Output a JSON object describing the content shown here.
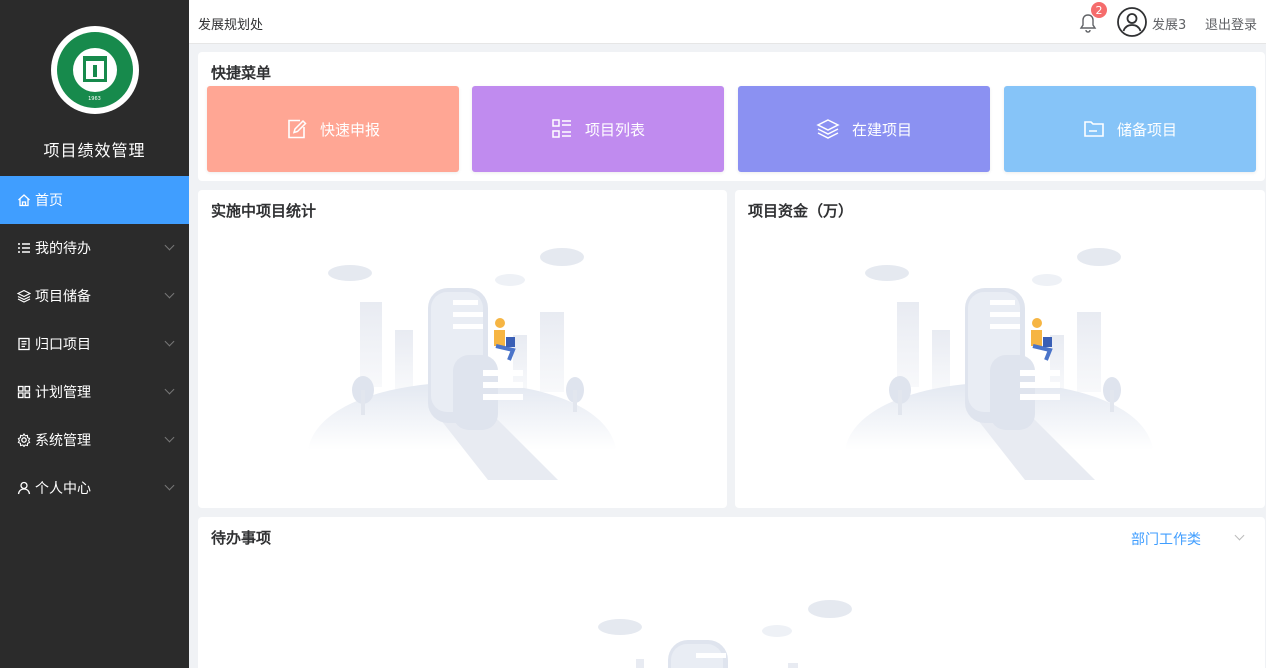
{
  "app": {
    "title": "项目绩效管理",
    "logo_year": "1963"
  },
  "sidebar": {
    "items": [
      {
        "label": "首页",
        "icon": "home-icon",
        "active": true
      },
      {
        "label": "我的待办",
        "icon": "list-icon",
        "active": false
      },
      {
        "label": "项目储备",
        "icon": "layers-icon",
        "active": false
      },
      {
        "label": "归口项目",
        "icon": "document-icon",
        "active": false
      },
      {
        "label": "计划管理",
        "icon": "grid-icon",
        "active": false
      },
      {
        "label": "系统管理",
        "icon": "gear-icon",
        "active": false
      },
      {
        "label": "个人中心",
        "icon": "user-icon",
        "active": false
      }
    ]
  },
  "header": {
    "title": "发展规划处",
    "notification_count": "2",
    "username": "发展3",
    "logout_label": "退出登录"
  },
  "quick_menu": {
    "title": "快捷菜单",
    "tiles": [
      {
        "label": "快速申报",
        "icon": "edit-icon",
        "color": "#ffa694"
      },
      {
        "label": "项目列表",
        "icon": "list-grid-icon",
        "color": "#c08bef"
      },
      {
        "label": "在建项目",
        "icon": "layers-icon",
        "color": "#8b91f2"
      },
      {
        "label": "储备项目",
        "icon": "folder-icon",
        "color": "#86c4f8"
      }
    ]
  },
  "stats_panel": {
    "title": "实施中项目统计"
  },
  "funds_panel": {
    "title": "项目资金（万）"
  },
  "todo_panel": {
    "title": "待办事项",
    "filter_value": "部门工作类"
  },
  "colors": {
    "sidebar_bg": "#2b2b2b",
    "active_bg": "#409eff",
    "badge": "#f56c6c"
  }
}
